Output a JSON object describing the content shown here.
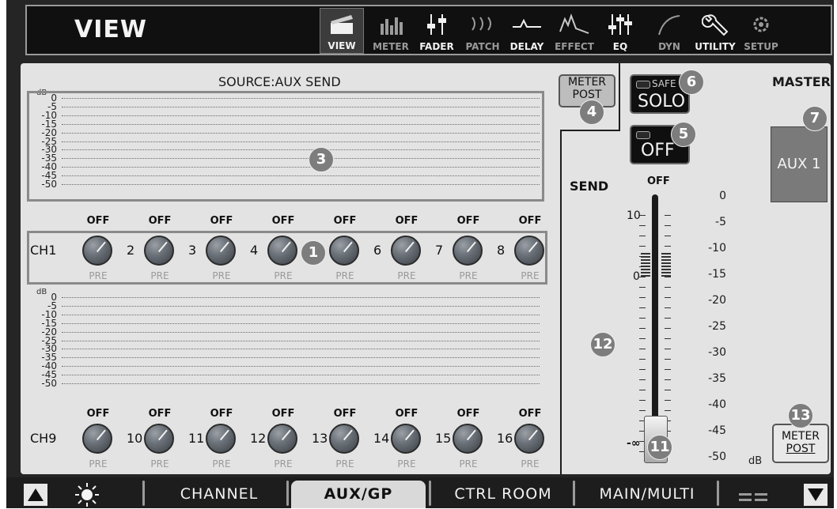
{
  "header": {
    "title": "VIEW",
    "nav": [
      {
        "label": "VIEW",
        "icon": "view-icon",
        "active": true
      },
      {
        "label": "METER",
        "icon": "meter-icon",
        "dim": true
      },
      {
        "label": "FADER",
        "icon": "fader-icon"
      },
      {
        "label": "PATCH",
        "icon": "patch-icon",
        "dim": true
      },
      {
        "label": "DELAY",
        "icon": "delay-icon"
      },
      {
        "label": "EFFECT",
        "icon": "effect-icon",
        "dim": true
      },
      {
        "label": "EQ",
        "icon": "eq-icon"
      },
      {
        "label": "DYN",
        "icon": "dyn-icon",
        "dim": true
      },
      {
        "label": "UTILITY",
        "icon": "utility-icon"
      },
      {
        "label": "SETUP",
        "icon": "setup-icon",
        "dim": true
      }
    ]
  },
  "main": {
    "source_label": "SOURCE:AUX SEND",
    "db_unit": "dB",
    "scale": [
      "0",
      "-5",
      "-10",
      "-15",
      "-20",
      "-25",
      "-30",
      "-35",
      "-40",
      "-45",
      "-50"
    ],
    "bank1": {
      "ch_labels": [
        "CH1",
        "2",
        "3",
        "4",
        "5",
        "6",
        "7",
        "8"
      ],
      "off_labels": [
        "OFF",
        "OFF",
        "OFF",
        "OFF",
        "OFF",
        "OFF",
        "OFF",
        "OFF"
      ],
      "pre_labels": [
        "PRE",
        "PRE",
        "PRE",
        "PRE",
        "PRE",
        "PRE",
        "PRE",
        "PRE"
      ]
    },
    "bank2": {
      "ch_labels": [
        "CH9",
        "10",
        "11",
        "12",
        "13",
        "14",
        "15",
        "16"
      ],
      "off_labels": [
        "OFF",
        "OFF",
        "OFF",
        "OFF",
        "OFF",
        "OFF",
        "OFF",
        "OFF"
      ],
      "pre_labels": [
        "PRE",
        "PRE",
        "PRE",
        "PRE",
        "PRE",
        "PRE",
        "PRE",
        "PRE"
      ]
    },
    "badges": {
      "b1": "1",
      "b3": "3",
      "b4": "4",
      "b5": "5",
      "b6": "6",
      "b7": "7",
      "b11": "11",
      "b12": "12",
      "b13": "13"
    }
  },
  "right": {
    "meter_post_top": {
      "line1": "METER",
      "line2": "POST"
    },
    "safe_label": "SAFE",
    "solo_label": "SOLO",
    "off_button": "OFF",
    "master_label": "MASTER",
    "aux_button": "AUX 1",
    "send_label": "SEND",
    "fader_off_label": "OFF",
    "fader_left_scale": [
      "10",
      "0",
      "-∞"
    ],
    "fader_right_scale": [
      "0",
      "-5",
      "-10",
      "-15",
      "-20",
      "-25",
      "-30",
      "-35",
      "-40",
      "-45",
      "-50"
    ],
    "fader_db_unit": "dB",
    "meter_post_bottom": {
      "line1": "METER",
      "line2": "POST"
    }
  },
  "footer": {
    "tabs": [
      "CHANNEL",
      "AUX/GP",
      "CTRL ROOM",
      "MAIN/MULTI"
    ],
    "active_tab": "AUX/GP"
  },
  "colors": {
    "frame": "#252525",
    "panel": "#e3e3e3",
    "badge": "#7d7d7d",
    "knob": "#6b7178"
  }
}
